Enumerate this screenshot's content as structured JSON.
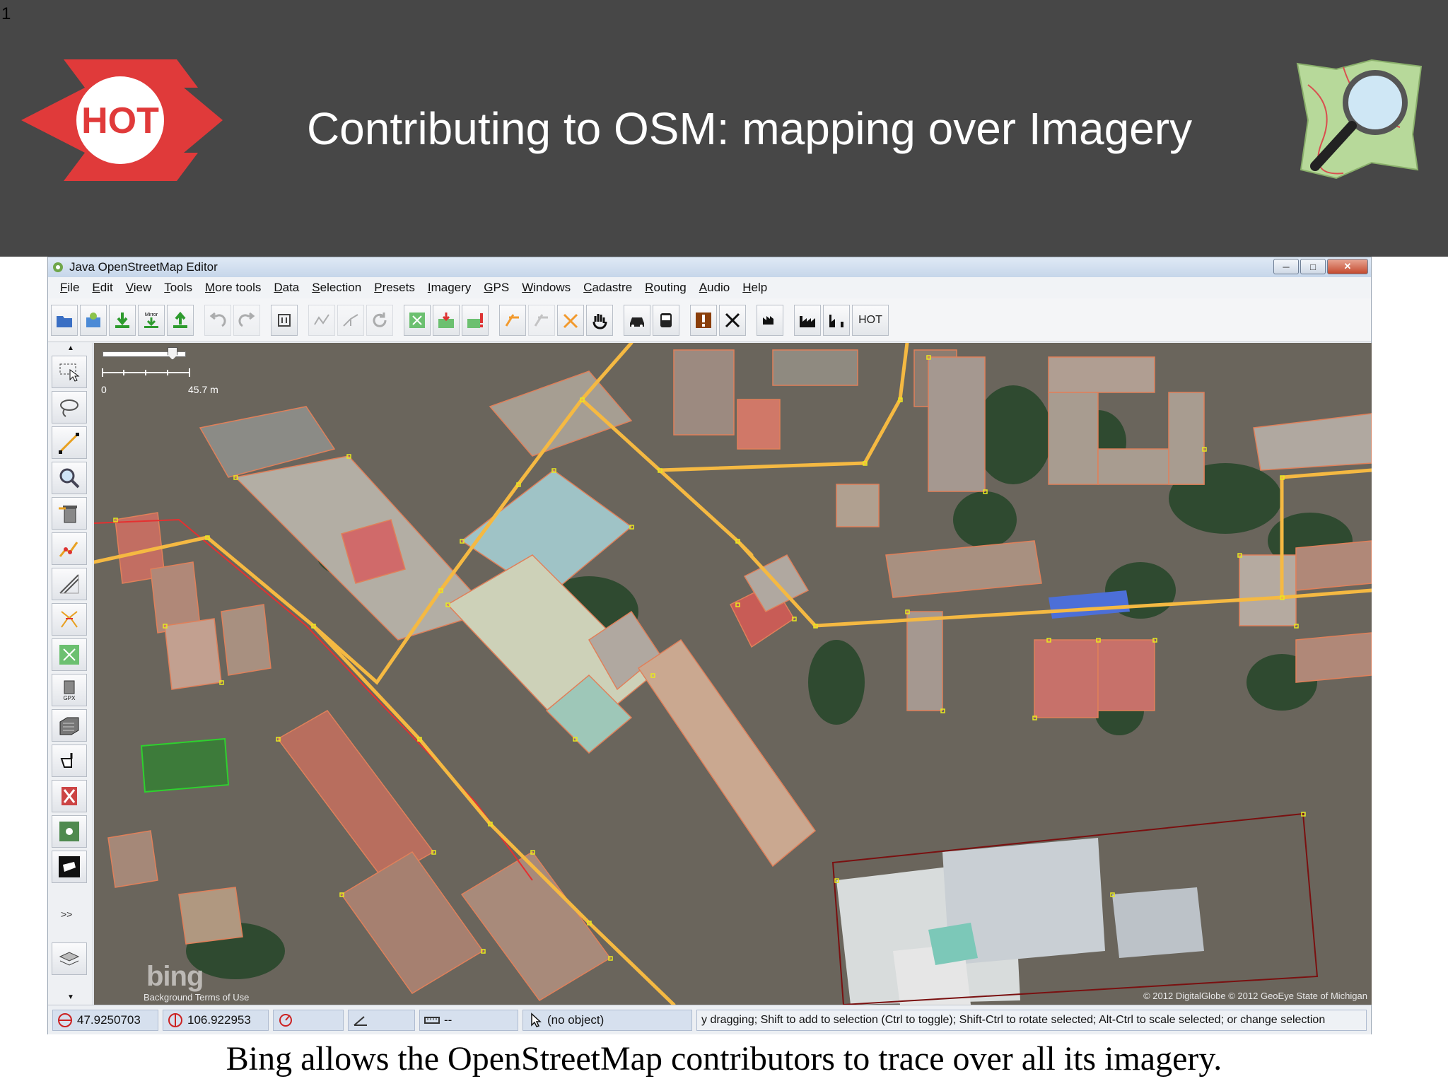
{
  "slide": {
    "number": "1",
    "title": "Contributing to OSM: mapping over Imagery",
    "caption": "Bing allows the OpenStreetMap contributors to trace over all its imagery.",
    "hot_logo_text": "HOT",
    "header_color": "#474747",
    "hot_red": "#e03a3a"
  },
  "window": {
    "title": "Java OpenStreetMap Editor",
    "controls": [
      "minimize-icon",
      "maximize-icon",
      "close-icon"
    ]
  },
  "menubar": {
    "items": [
      "File",
      "Edit",
      "View",
      "Tools",
      "More tools",
      "Data",
      "Selection",
      "Presets",
      "Imagery",
      "GPS",
      "Windows",
      "Cadastre",
      "Routing",
      "Audio",
      "Help"
    ]
  },
  "toolbar": {
    "mirror_label": "Mirror",
    "hot_label": "HOT",
    "icons": [
      "open-file-icon",
      "open-location-icon",
      "download-icon",
      "mirror-download-icon",
      "upload-icon",
      "undo-icon",
      "redo-icon",
      "preferences-icon",
      "simplify-way-icon",
      "split-way-icon",
      "refresh-icon",
      "zoom-to-layer-icon",
      "download-along-icon",
      "validation-icon",
      "routing-a-icon",
      "routing-b-icon",
      "routing-c-icon",
      "hand-icon",
      "car-icon",
      "bus-icon",
      "warning-icon",
      "cross-tool-icon",
      "building-icon",
      "industrial-icon",
      "elevation-icon"
    ]
  },
  "sidebar": {
    "tools": [
      "select-tool-icon",
      "lasso-tool-icon",
      "draw-tool-icon",
      "zoom-tool-icon",
      "delete-tool-icon",
      "improve-way-icon",
      "parallel-way-icon",
      "extrude-icon",
      "zoom-extent-icon",
      "gpx-icon",
      "building-tool-icon",
      "hand-pointer-icon",
      "conflict-icon",
      "node-tool-icon",
      "black-shape-icon"
    ],
    "more_label": ">>"
  },
  "map": {
    "scale_start": "0",
    "scale_end": "45.7 m",
    "bing_logo": "bing",
    "links_label": "Background Terms of Use",
    "copyright": "© 2012 DigitalGlobe © 2012 GeoEye State of Michigan",
    "road_color": "#f5b942",
    "node_color": "#e8e820",
    "building_outline_color": "#e0805a"
  },
  "statusbar": {
    "latitude": "47.9250703",
    "longitude": "106.922953",
    "heading": "",
    "angle": "",
    "distance": "--",
    "object": "(no object)",
    "help": "y dragging; Shift to add to selection (Ctrl to toggle); Shift-Ctrl to rotate selected; Alt-Ctrl to scale selected; or change selection"
  }
}
